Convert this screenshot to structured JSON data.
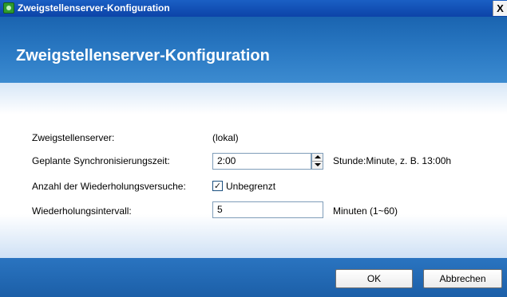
{
  "window": {
    "title": "Zweigstellenserver-Konfiguration",
    "close_glyph": "X"
  },
  "header": {
    "title": "Zweigstellenserver-Konfiguration"
  },
  "form": {
    "server_label": "Zweigstellenserver:",
    "server_value": "(lokal)",
    "sync_time_label": "Geplante Synchronisierungszeit:",
    "sync_time_value": "2:00",
    "sync_time_hint": "Stunde:Minute, z. B. 13:00h",
    "retry_count_label": "Anzahl der Wiederholungsversuche:",
    "retry_count_checkbox_label": "Unbegrenzt",
    "retry_count_checked": true,
    "retry_interval_label": "Wiederholungsintervall:",
    "retry_interval_value": "5",
    "retry_interval_hint": "Minuten (1~60)"
  },
  "buttons": {
    "ok": "OK",
    "cancel": "Abbrechen"
  },
  "colors": {
    "title_bar": "#0c43a8",
    "header": "#2b7ac4",
    "footer": "#1c5fa8"
  }
}
